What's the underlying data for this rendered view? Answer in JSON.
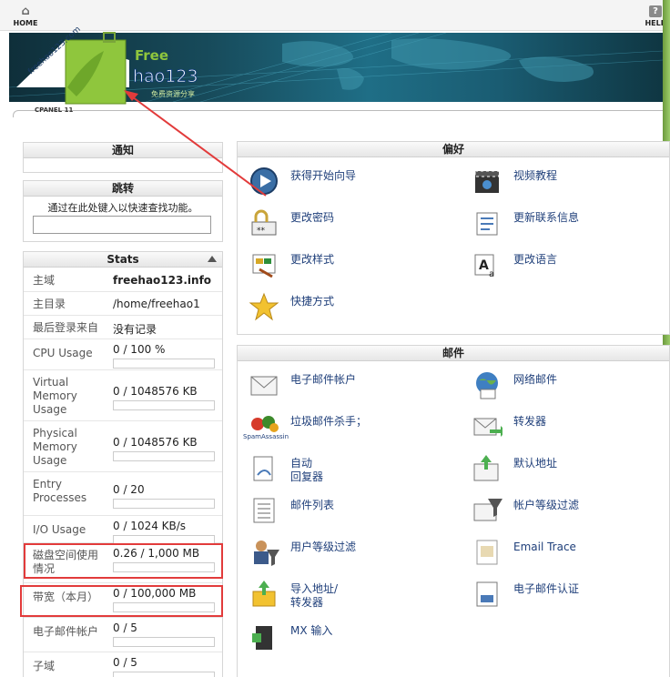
{
  "top": {
    "home_label": "HOME",
    "help_label": "HELP"
  },
  "banner": {
    "logo_text": "hao123",
    "logo_free": "Free",
    "logo_domain": "freehao123.com",
    "logo_tagline": "免费资源分享"
  },
  "cpanel_tab": "CPANEL 11",
  "notice": {
    "title": "通知"
  },
  "jump": {
    "title": "跳转",
    "description": "通过在此处键入以快速查找功能。",
    "value": ""
  },
  "stats": {
    "title": "Stats",
    "rows": [
      {
        "label": "主域",
        "value": "freehao123.info",
        "bold": true
      },
      {
        "label": "主目录",
        "value": "/home/freehao1"
      },
      {
        "label": "最后登录来自",
        "value": "没有记录"
      },
      {
        "label": "CPU Usage",
        "value": "0 / 100 %",
        "fill": 0
      },
      {
        "label": "Virtual Memory Usage",
        "value": "0 / 1048576 KB",
        "fill": 0
      },
      {
        "label": "Physical Memory Usage",
        "value": "0 / 1048576 KB",
        "fill": 0
      },
      {
        "label": "Entry Processes",
        "value": "0 / 20",
        "fill": 0
      },
      {
        "label": "I/O Usage",
        "value": "0 / 1024 KB/s",
        "fill": 0
      },
      {
        "label": "磁盘空间使用情况",
        "value": "0.26 / 1,000 MB",
        "fill": 0.00026
      },
      {
        "label": "带宽（本月）",
        "value": "0 / 100,000 MB",
        "fill": 0
      },
      {
        "label": "电子邮件帐户",
        "value": "0 / 5",
        "fill": 0
      },
      {
        "label": "子域",
        "value": "0 / 5",
        "fill": 0
      }
    ]
  },
  "preferences": {
    "title": "偏好",
    "items": [
      {
        "label": "获得开始向导",
        "icon": "play-circle-icon"
      },
      {
        "label": "视频教程",
        "icon": "clapperboard-icon"
      },
      {
        "label": "更改密码",
        "icon": "lock-password-icon"
      },
      {
        "label": "更新联系信息",
        "icon": "contact-card-icon"
      },
      {
        "label": "更改样式",
        "icon": "palette-icon"
      },
      {
        "label": "更改语言",
        "icon": "language-icon"
      },
      {
        "label": "快捷方式",
        "icon": "star-icon"
      }
    ]
  },
  "mail": {
    "title": "邮件",
    "items": [
      {
        "label": "电子邮件帐户",
        "icon": "envelope-icon"
      },
      {
        "label": "网络邮件",
        "icon": "globe-mail-icon"
      },
      {
        "label": "垃圾邮件杀手；",
        "icon": "spamassassin-icon",
        "sublabel": "SpamAssassin"
      },
      {
        "label": "转发器",
        "icon": "forward-mail-icon"
      },
      {
        "label": "自动\n回复器",
        "icon": "autoresponder-icon"
      },
      {
        "label": "默认地址",
        "icon": "default-address-icon"
      },
      {
        "label": "邮件列表",
        "icon": "mailing-list-icon"
      },
      {
        "label": "帐户等级过滤",
        "icon": "account-filter-icon"
      },
      {
        "label": "用户等级过滤",
        "icon": "user-filter-icon"
      },
      {
        "label": "Email Trace",
        "icon": "email-trace-icon"
      },
      {
        "label": "导入地址/\n转发器",
        "icon": "import-icon"
      },
      {
        "label": "电子邮件认证",
        "icon": "email-auth-icon"
      },
      {
        "label": "MX 输入",
        "icon": "mx-entry-icon"
      }
    ]
  },
  "colors": {
    "link": "#1f3f7a",
    "highlight": "#e23b3b",
    "bar_fill": "#9fc86a"
  }
}
